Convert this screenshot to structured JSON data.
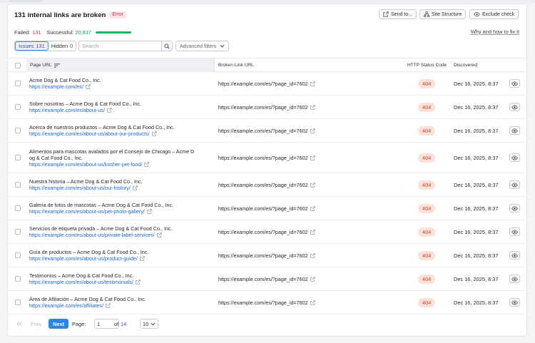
{
  "header": {
    "title": "131 internal links are broken",
    "badge": "Error",
    "send_to_label": "Send to...",
    "site_structure_label": "Site Structure",
    "exclude_check_label": "Exclude check"
  },
  "stats": {
    "failed_label": "Failed:",
    "failed_value": "131",
    "successful_label": "Successful:",
    "successful_value": "20,837",
    "success_fraction": 0.994,
    "help_link": "Why and how to fix it"
  },
  "filters": {
    "issues_label": "Issues",
    "issues_count": "131",
    "hidden_label": "Hidden",
    "hidden_count": "0",
    "search_placeholder": "Search",
    "advanced_label": "Advanced filters"
  },
  "columns": {
    "page_url": "Page URL",
    "broken_link": "Broken Link URL",
    "status_code": "HTTP Status Code",
    "discovered": "Discovered"
  },
  "rows": [
    {
      "title": "Acme Dog & Cat Food Co., Inc.",
      "url": "https://example.com/es/",
      "broken": "https://example.com/es/?page_id=7602",
      "status": "404",
      "date": "Dec 16, 2025, 8:37"
    },
    {
      "title": "Sobre nosotras – Acme Dog & Cat Food Co., Inc.",
      "url": "https://example.com/es/about-us/",
      "broken": "https://example.com/es/?page_id=7602",
      "status": "404",
      "date": "Dec 16, 2025, 8:37"
    },
    {
      "title": "Acerca de nuestros productos – Acme Dog & Cat Food Co., Inc.",
      "url": "https://example.com/es/about-us/about-our-products/",
      "broken": "https://example.com/es/?page_id=7602",
      "status": "404",
      "date": "Dec 16, 2025, 8:37"
    },
    {
      "title": "Alimentos para mascotas avalados por el Consejo de Chicago – Acme D",
      "title2": "og & Cat Food Co., Inc.",
      "url": "https://example.com/es/about-us/kosher-pet-food/",
      "broken": "https://example.com/es/?page_id=7602",
      "status": "404",
      "date": "Dec 16, 2025, 8:37"
    },
    {
      "title": "Nuestra historia – Acme Dog & Cat Food Co., Inc.",
      "url": "https://example.com/es/about-us/our-history/",
      "broken": "https://example.com/es/?page_id=7602",
      "status": "404",
      "date": "Dec 16, 2025, 8:37"
    },
    {
      "title": "Galería de fotos de mascotas – Acme Dog & Cat Food Co., Inc.",
      "url": "https://example.com/es/about-us/pet-photo-gallery/",
      "broken": "https://example.com/es/?page_id=7602",
      "status": "404",
      "date": "Dec 16, 2025, 8:37"
    },
    {
      "title": "Servicios de etiqueta privada – Acme Dog & Cat Food Co., Inc.",
      "url": "https://example.com/es/about-us/private-label-services/",
      "broken": "https://example.com/es/?page_id=7602",
      "status": "404",
      "date": "Dec 16, 2025, 8:37"
    },
    {
      "title": "Guía de productos – Acme Dog & Cat Food Co., Inc.",
      "url": "https://example.com/es/about-us/product-guide/",
      "broken": "https://example.com/es/?page_id=7602",
      "status": "404",
      "date": "Dec 16, 2025, 8:37"
    },
    {
      "title": "Testimonios – Acme Dog & Cat Food Co., Inc.",
      "url": "https://example.com/es/about-us/testimonials/",
      "broken": "https://example.com/es/?page_id=7602",
      "status": "404",
      "date": "Dec 16, 2025, 8:37"
    },
    {
      "title": "Área de Afiliación – Acme Dog & Cat Food Co., Inc.",
      "url": "https://example.com/es/affiliates/",
      "broken": "https://example.com/es/?page_id=7602",
      "status": "404",
      "date": "Dec 16, 2025, 8:37"
    }
  ],
  "pagination": {
    "prev_label": "Prev",
    "next_label": "Next",
    "page_label": "Page:",
    "current_page": "1",
    "of_label": "of",
    "total_pages": "14",
    "per_page": "10"
  },
  "colors": {
    "accent": "#2a86e6",
    "error": "#d52e4e",
    "success": "#12b76a",
    "status_bg": "#fde1d8"
  }
}
